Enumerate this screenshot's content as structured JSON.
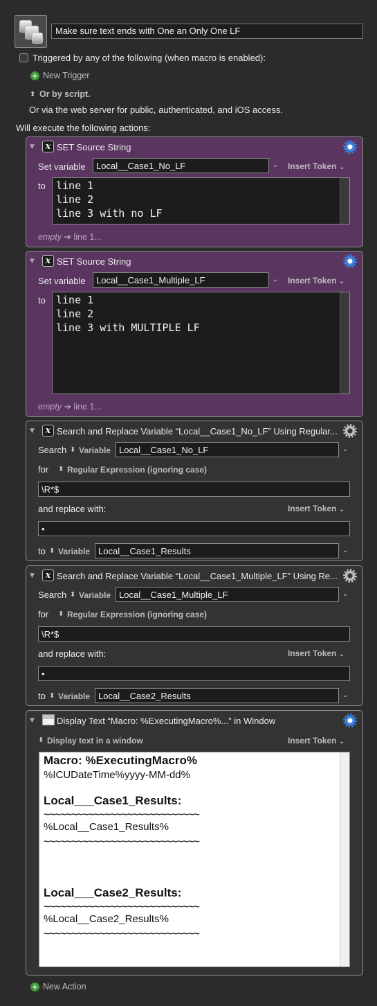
{
  "macro": {
    "name": "Make sure text ends with One an Only One  LF"
  },
  "triggers": {
    "checkbox_label": "Triggered by any of the following (when macro is enabled):",
    "new_trigger": "New Trigger",
    "or_by_script": "Or by script.",
    "web_server": "Or via the web server for public, authenticated, and iOS access.",
    "will_execute": "Will execute the following actions:"
  },
  "actions": [
    {
      "title": "SET Source String",
      "set_variable_label": "Set variable",
      "variable": "Local__Case1_No_LF",
      "insert_token": "Insert Token",
      "to_label": "to",
      "text": "line 1\nline 2\nline 3 with no LF",
      "summary_empty": "empty",
      "summary_arrow": "➔",
      "summary_value": "line 1..."
    },
    {
      "title": "SET Source String",
      "set_variable_label": "Set variable",
      "variable": "Local__Case1_Multiple_LF",
      "insert_token": "Insert Token",
      "to_label": "to",
      "text": "line 1\nline 2\nline 3 with MULTIPLE LF",
      "summary_empty": "empty",
      "summary_arrow": "➔",
      "summary_value": "line 1..."
    },
    {
      "title": "Search and Replace Variable “Local__Case1_No_LF” Using Regular...",
      "search_label": "Search",
      "variable_kind": "Variable",
      "search_variable": "Local__Case1_No_LF",
      "for_label": "for",
      "match_mode": "Regular Expression (ignoring case)",
      "pattern": "\\R*$",
      "replace_label": "and replace with:",
      "insert_token": "Insert Token",
      "replacement": "•",
      "to_label": "to",
      "to_kind": "Variable",
      "to_variable": "Local__Case1_Results"
    },
    {
      "title": "Search and Replace Variable “Local__Case1_Multiple_LF” Using Re...",
      "search_label": "Search",
      "variable_kind": "Variable",
      "search_variable": "Local__Case1_Multiple_LF",
      "for_label": "for",
      "match_mode": "Regular Expression (ignoring case)",
      "pattern": "\\R*$",
      "replace_label": "and replace with:",
      "insert_token": "Insert Token",
      "replacement": "•",
      "to_label": "to",
      "to_kind": "Variable",
      "to_variable": "Local__Case2_Results"
    },
    {
      "title": "Display Text “Macro:  %ExecutingMacro%...” in Window",
      "mode": "Display text in a window",
      "insert_token": "Insert Token",
      "lines": {
        "l1": "Macro:  %ExecutingMacro%",
        "l2": "%ICUDateTime%yyyy-MM-dd%",
        "l3": "Local___Case1_Results:",
        "l4": "~~~~~~~~~~~~~~~~~~~~~~~~~~~~",
        "l5": "%Local__Case1_Results%",
        "l6": "~~~~~~~~~~~~~~~~~~~~~~~~~~~~",
        "l7": "Local___Case2_Results:",
        "l8": "~~~~~~~~~~~~~~~~~~~~~~~~~~~~",
        "l9": "%Local__Case2_Results%",
        "l10": "~~~~~~~~~~~~~~~~~~~~~~~~~~~~"
      }
    }
  ],
  "new_action": "New Action",
  "colors": {
    "background": "#2b2b2b",
    "set_action": "#5a3560",
    "other_action": "#333333",
    "gear_blue": "#3b7fe0",
    "plus_green": "#3f9b3a"
  }
}
